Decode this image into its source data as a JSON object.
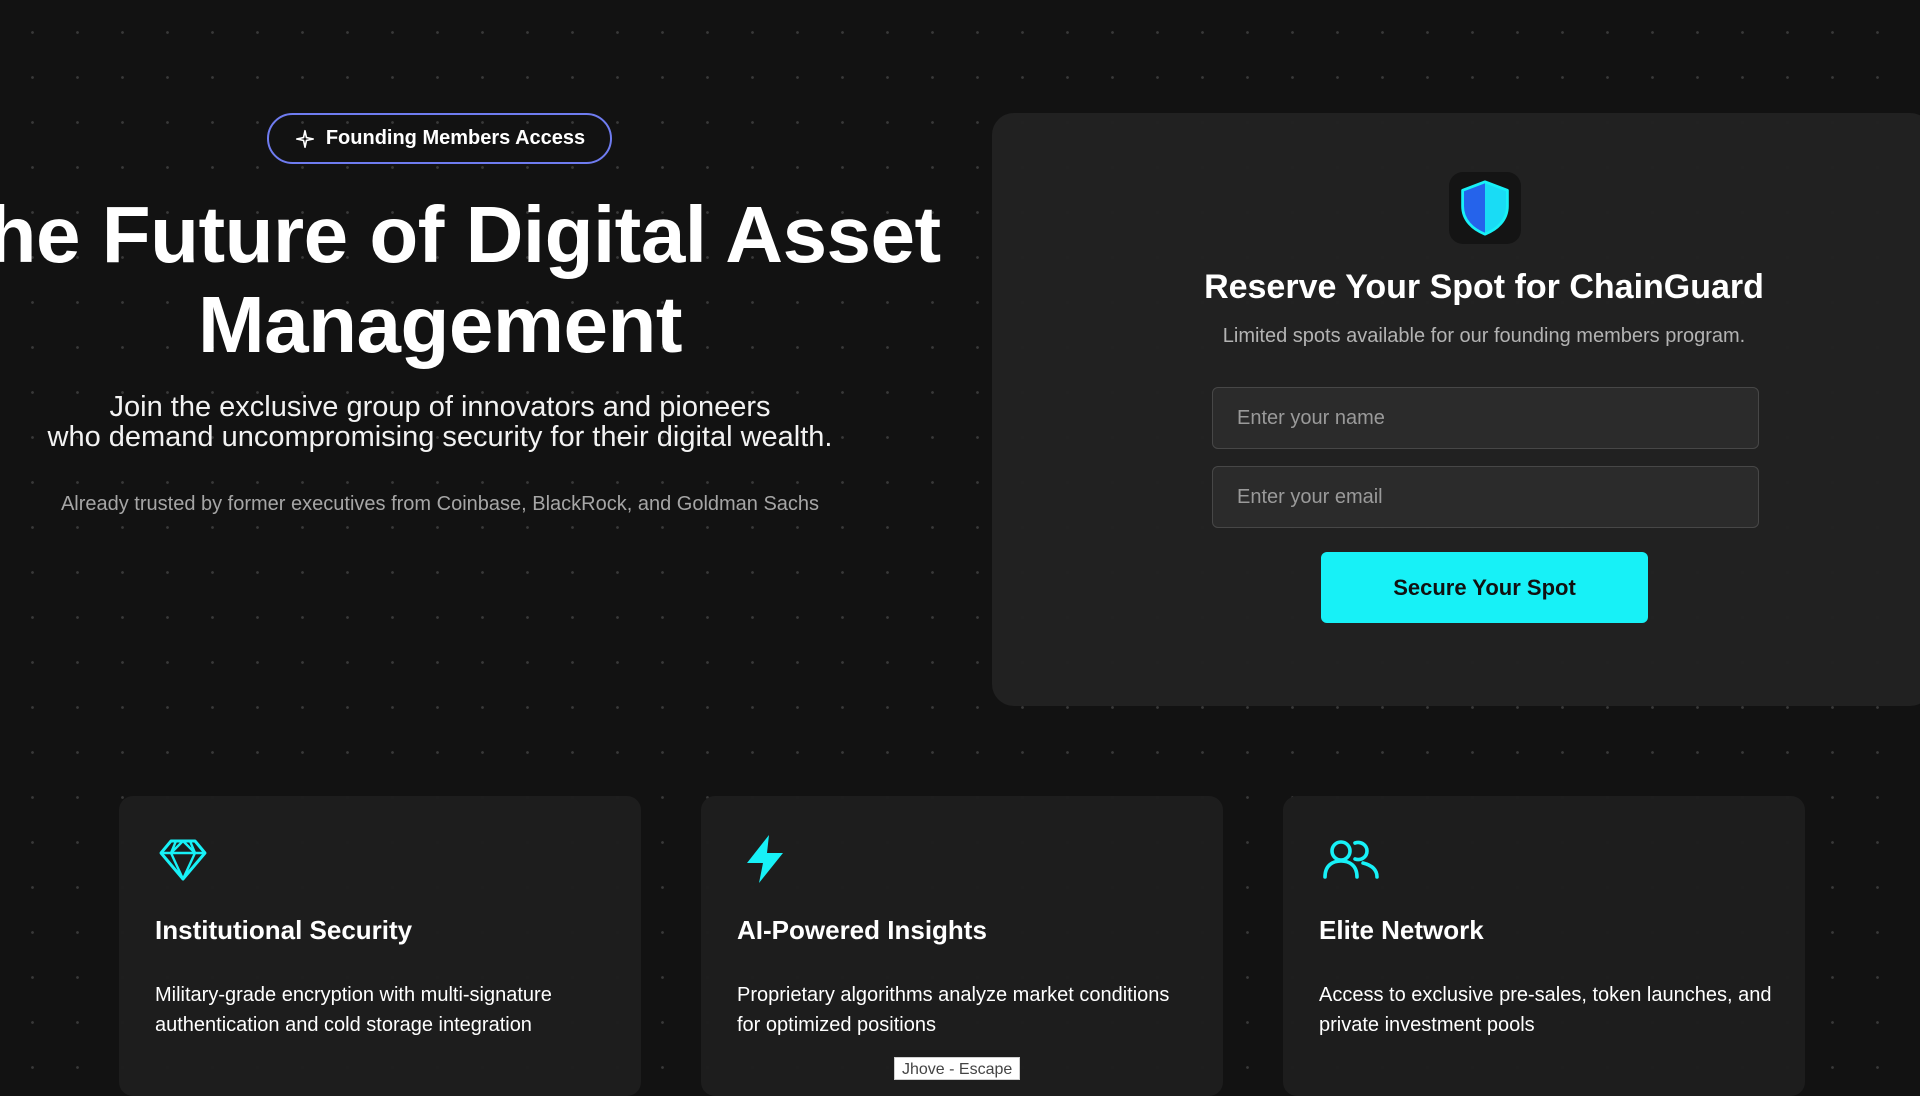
{
  "hero": {
    "badge": "Founding Members Access",
    "title_line1": "The Future of Digital Asset",
    "title_line2": "Management",
    "subtitle_line1": "Join the exclusive group of innovators and pioneers",
    "subtitle_line2": "who demand uncompromising security for their digital wealth.",
    "trusted": "Already trusted by former executives from Coinbase, BlackRock, and Goldman Sachs"
  },
  "reserve": {
    "title": "Reserve Your Spot for ChainGuard",
    "subtitle": "Limited spots available for our founding members program.",
    "name_placeholder": "Enter your name",
    "email_placeholder": "Enter your email",
    "cta": "Secure Your Spot",
    "icon": "shield-icon"
  },
  "features": [
    {
      "icon": "diamond-icon",
      "title": "Institutional Security",
      "desc": "Military-grade encryption with multi-signature authentication and cold storage integration"
    },
    {
      "icon": "lightning-icon",
      "title": "AI-Powered Insights",
      "desc": "Proprietary algorithms analyze market conditions for optimized positions"
    },
    {
      "icon": "users-icon",
      "title": "Elite Network",
      "desc": "Access to exclusive pre-sales, token launches, and private investment pools"
    }
  ],
  "tooltip": "Jhove - Escape",
  "colors": {
    "accent": "#17f1f7",
    "badge_border": "#6f7cf0",
    "background": "#121212",
    "card": "#222222",
    "shield_dark": "#2563eb"
  }
}
